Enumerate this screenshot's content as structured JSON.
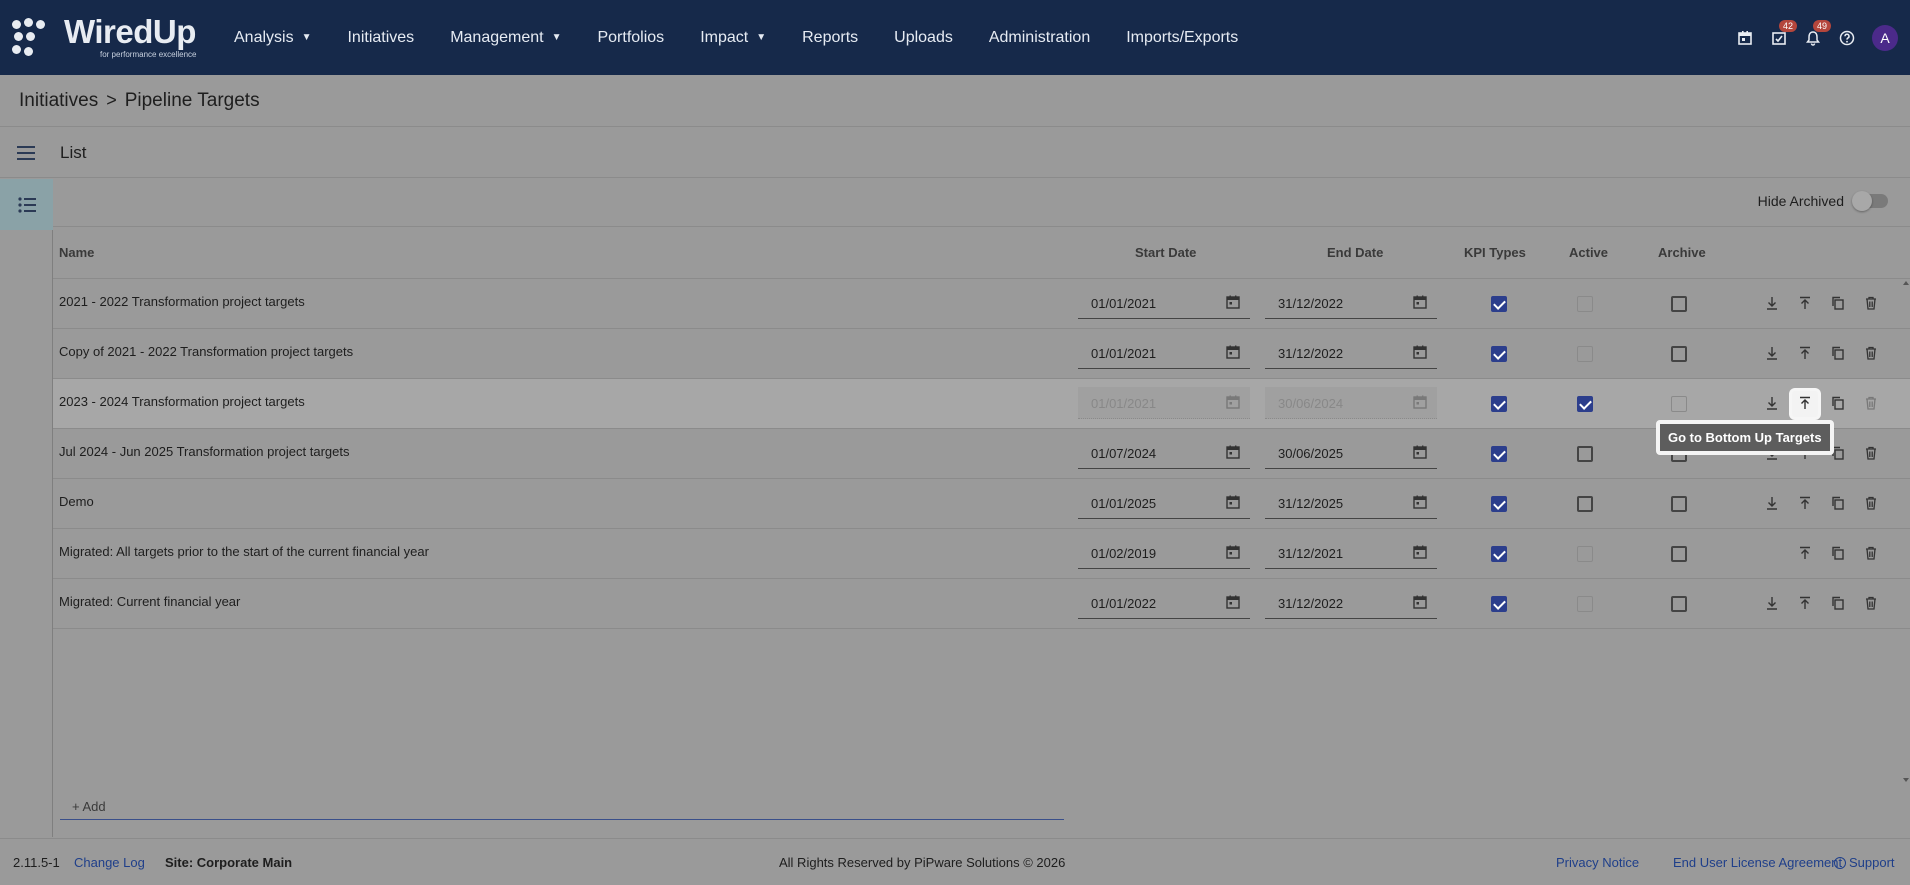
{
  "brand": {
    "name": "WiredUp",
    "tagline": "for performance excellence"
  },
  "nav": {
    "items": [
      {
        "label": "Analysis",
        "dropdown": true
      },
      {
        "label": "Initiatives",
        "dropdown": false
      },
      {
        "label": "Management",
        "dropdown": true
      },
      {
        "label": "Portfolios",
        "dropdown": false
      },
      {
        "label": "Impact",
        "dropdown": true
      },
      {
        "label": "Reports",
        "dropdown": false
      },
      {
        "label": "Uploads",
        "dropdown": false
      },
      {
        "label": "Administration",
        "dropdown": false
      },
      {
        "label": "Imports/Exports",
        "dropdown": false
      }
    ],
    "tasks_badge": "42",
    "notifications_badge": "49",
    "avatar_initial": "A"
  },
  "breadcrumb": {
    "parent": "Initiatives",
    "separator": ">",
    "current": "Pipeline Targets"
  },
  "listbar": {
    "label": "List"
  },
  "toolbar": {
    "hide_archived_label": "Hide Archived",
    "hide_archived": false
  },
  "table": {
    "headers": {
      "name": "Name",
      "start": "Start Date",
      "end": "End Date",
      "kpi": "KPI Types",
      "active": "Active",
      "archive": "Archive"
    },
    "rows": [
      {
        "name": "2021 - 2022 Transformation project targets",
        "start": "01/01/2021",
        "end": "31/12/2022",
        "kpi": true,
        "active": false,
        "active_disabled": true,
        "archive": false,
        "archive_disabled": false,
        "date_disabled": false,
        "down": true,
        "highlight": false
      },
      {
        "name": "Copy of 2021 - 2022 Transformation project targets",
        "start": "01/01/2021",
        "end": "31/12/2022",
        "kpi": true,
        "active": false,
        "active_disabled": true,
        "archive": false,
        "archive_disabled": false,
        "date_disabled": false,
        "down": true,
        "highlight": false
      },
      {
        "name": "2023 - 2024 Transformation project targets",
        "start": "01/01/2021",
        "end": "30/06/2024",
        "kpi": true,
        "active": true,
        "active_disabled": false,
        "archive": false,
        "archive_disabled": true,
        "date_disabled": true,
        "down": true,
        "highlight": true
      },
      {
        "name": "Jul 2024 - Jun 2025 Transformation project targets",
        "start": "01/07/2024",
        "end": "30/06/2025",
        "kpi": true,
        "active": false,
        "active_disabled": false,
        "archive": false,
        "archive_disabled": false,
        "date_disabled": false,
        "down": true,
        "highlight": false
      },
      {
        "name": "Demo",
        "start": "01/01/2025",
        "end": "31/12/2025",
        "kpi": true,
        "active": false,
        "active_disabled": false,
        "archive": false,
        "archive_disabled": false,
        "date_disabled": false,
        "down": true,
        "highlight": false
      },
      {
        "name": "Migrated: All targets prior to the start of the current financial year",
        "start": "01/02/2019",
        "end": "31/12/2021",
        "kpi": true,
        "active": false,
        "active_disabled": true,
        "archive": false,
        "archive_disabled": false,
        "date_disabled": false,
        "down": false,
        "highlight": false
      },
      {
        "name": "Migrated: Current financial year",
        "start": "01/01/2022",
        "end": "31/12/2022",
        "kpi": true,
        "active": false,
        "active_disabled": true,
        "archive": false,
        "archive_disabled": false,
        "date_disabled": false,
        "down": true,
        "highlight": false
      }
    ]
  },
  "tooltip": {
    "text": "Go to Bottom Up Targets"
  },
  "add": {
    "placeholder": "+ Add"
  },
  "footer": {
    "version": "2.11.5-1",
    "changelog": "Change Log",
    "site": "Site: Corporate Main",
    "copyright": "All Rights Reserved by PiPware Solutions © 2026",
    "privacy": "Privacy Notice",
    "eula": "End User License Agreement",
    "support": "Support"
  }
}
